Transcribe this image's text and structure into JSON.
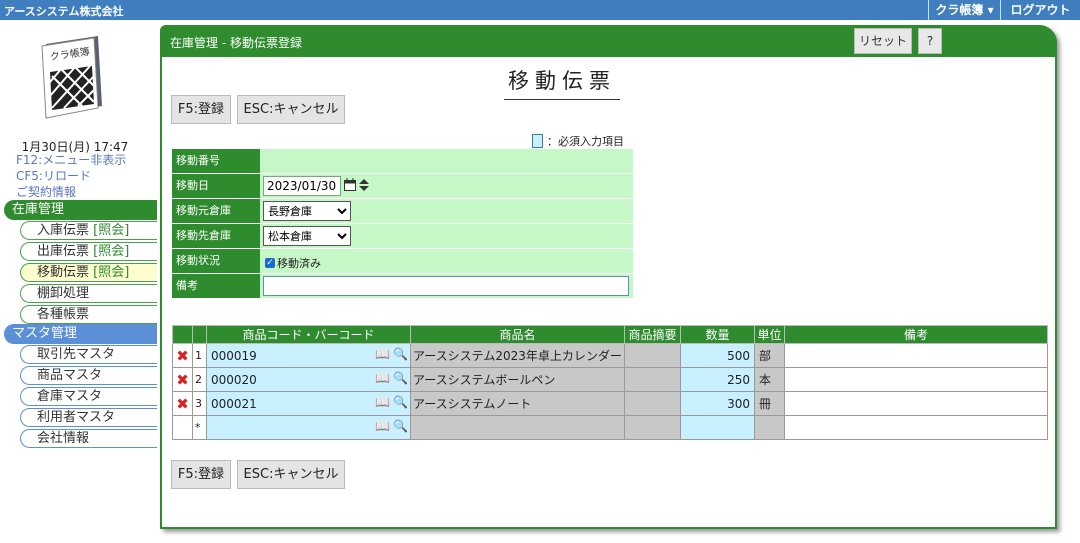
{
  "topbar": {
    "company": "アースシステム株式会社",
    "app_menu": "クラ帳簿 ▾",
    "logout": "ログアウト"
  },
  "sidebar": {
    "logo_text": "クラ帳簿",
    "datetime": "1月30日(月) 17:47",
    "links": [
      "F12:メニュー非表示",
      "CF5:リロード",
      "ご契約情報"
    ],
    "inventory_head": "在庫管理",
    "inventory_items": [
      {
        "label": "入庫伝票",
        "ref": "[照会]"
      },
      {
        "label": "出庫伝票",
        "ref": "[照会]"
      },
      {
        "label": "移動伝票",
        "ref": "[照会]"
      },
      {
        "label": "棚卸処理",
        "ref": ""
      },
      {
        "label": "各種帳票",
        "ref": ""
      }
    ],
    "master_head": "マスタ管理",
    "master_items": [
      "取引先マスタ",
      "商品マスタ",
      "倉庫マスタ",
      "利用者マスタ",
      "会社情報"
    ]
  },
  "panel": {
    "title": "在庫管理 - 移動伝票登録",
    "reset": "リセット",
    "help": "?",
    "doc_title": "移動伝票",
    "save": "F5:登録",
    "cancel": "ESC:キャンセル",
    "legend": "：必須入力項目"
  },
  "form": {
    "move_no_label": "移動番号",
    "move_no": "",
    "date_label": "移動日",
    "date": "2023/01/30",
    "from_label": "移動元倉庫",
    "from": "長野倉庫",
    "to_label": "移動先倉庫",
    "to": "松本倉庫",
    "status_label": "移動状況",
    "status": "移動済み",
    "memo_label": "備考",
    "memo": ""
  },
  "grid": {
    "headers": [
      "商品コード・バーコード",
      "商品名",
      "商品摘要",
      "数量",
      "単位",
      "備考"
    ],
    "rows": [
      {
        "no": "1",
        "code": "000019",
        "name": "アースシステム2023年卓上カレンダー",
        "summary": "",
        "qty": "500",
        "unit": "部",
        "memo": ""
      },
      {
        "no": "2",
        "code": "000020",
        "name": "アースシステムボールペン",
        "summary": "",
        "qty": "250",
        "unit": "本",
        "memo": ""
      },
      {
        "no": "3",
        "code": "000021",
        "name": "アースシステムノート",
        "summary": "",
        "qty": "300",
        "unit": "冊",
        "memo": ""
      }
    ],
    "new_row_mark": "*"
  }
}
